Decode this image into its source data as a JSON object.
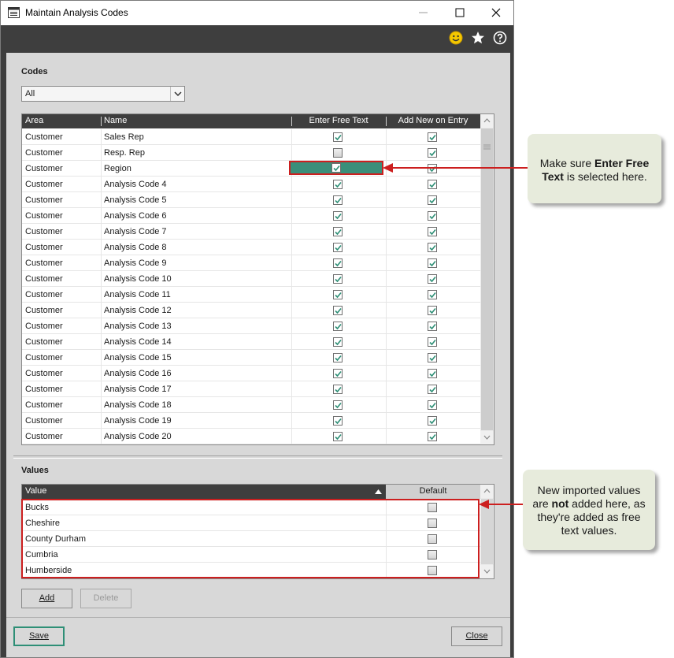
{
  "window": {
    "title": "Maintain Analysis Codes"
  },
  "codes": {
    "section_label": "Codes",
    "filter_value": "All",
    "columns": [
      "Area",
      "Name",
      "Enter Free Text",
      "Add New on Entry"
    ],
    "rows": [
      {
        "area": "Customer",
        "name": "Sales Rep",
        "free_text": true,
        "add_new": true
      },
      {
        "area": "Customer",
        "name": "Resp. Rep",
        "free_text": false,
        "add_new": true
      },
      {
        "area": "Customer",
        "name": "Region",
        "free_text": true,
        "add_new": true,
        "selected": true
      },
      {
        "area": "Customer",
        "name": "Analysis Code 4",
        "free_text": true,
        "add_new": true
      },
      {
        "area": "Customer",
        "name": "Analysis Code 5",
        "free_text": true,
        "add_new": true
      },
      {
        "area": "Customer",
        "name": "Analysis Code 6",
        "free_text": true,
        "add_new": true
      },
      {
        "area": "Customer",
        "name": "Analysis Code 7",
        "free_text": true,
        "add_new": true
      },
      {
        "area": "Customer",
        "name": "Analysis Code 8",
        "free_text": true,
        "add_new": true
      },
      {
        "area": "Customer",
        "name": "Analysis Code 9",
        "free_text": true,
        "add_new": true
      },
      {
        "area": "Customer",
        "name": "Analysis Code 10",
        "free_text": true,
        "add_new": true
      },
      {
        "area": "Customer",
        "name": "Analysis Code 11",
        "free_text": true,
        "add_new": true
      },
      {
        "area": "Customer",
        "name": "Analysis Code 12",
        "free_text": true,
        "add_new": true
      },
      {
        "area": "Customer",
        "name": "Analysis Code 13",
        "free_text": true,
        "add_new": true
      },
      {
        "area": "Customer",
        "name": "Analysis Code 14",
        "free_text": true,
        "add_new": true
      },
      {
        "area": "Customer",
        "name": "Analysis Code 15",
        "free_text": true,
        "add_new": true
      },
      {
        "area": "Customer",
        "name": "Analysis Code 16",
        "free_text": true,
        "add_new": true
      },
      {
        "area": "Customer",
        "name": "Analysis Code 17",
        "free_text": true,
        "add_new": true
      },
      {
        "area": "Customer",
        "name": "Analysis Code 18",
        "free_text": true,
        "add_new": true
      },
      {
        "area": "Customer",
        "name": "Analysis Code 19",
        "free_text": true,
        "add_new": true
      },
      {
        "area": "Customer",
        "name": "Analysis Code 20",
        "free_text": true,
        "add_new": true
      }
    ]
  },
  "values": {
    "section_label": "Values",
    "columns": [
      "Value",
      "Default"
    ],
    "rows": [
      {
        "value": "Bucks",
        "default": false
      },
      {
        "value": "Cheshire",
        "default": false
      },
      {
        "value": "County Durham",
        "default": false
      },
      {
        "value": "Cumbria",
        "default": false
      },
      {
        "value": "Humberside",
        "default": false
      }
    ],
    "add_label": "Add",
    "delete_label": "Delete"
  },
  "footer": {
    "save_label": "Save",
    "close_label": "Close"
  },
  "callouts": {
    "free_text": {
      "pre": "Make sure ",
      "bold": "Enter Free Text",
      "post": " is selected here."
    },
    "values": {
      "pre": "New imported values are ",
      "bold": "not",
      "post": " added here, as they're added as free text values."
    }
  },
  "colors": {
    "toolbar": "#3e3e3e",
    "panel": "#d8d8d8",
    "highlight": "#cc1f1f",
    "selected_cell": "#3a8f7a",
    "check": "#2e8f76"
  },
  "icons": [
    "smiley-icon",
    "star-icon",
    "help-icon",
    "minimize-icon",
    "maximize-icon",
    "close-icon"
  ]
}
